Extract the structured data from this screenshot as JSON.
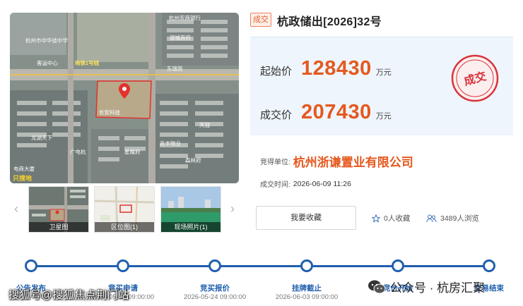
{
  "gallery": {
    "map_labels": [
      "杭州市中华技中学",
      "客运中心",
      "地铁1号线",
      "杭州农商银行",
      "银城首府",
      "东瑞苑",
      "长安科技",
      "天冠",
      "兆丰物业",
      "森林府",
      "龙湖天下",
      "星耀府",
      "广电杭",
      "电商大厦"
    ],
    "watermark_text": "只搜地",
    "thumbnails": [
      {
        "caption": "卫星图"
      },
      {
        "caption": "区位图(1)"
      },
      {
        "caption": "现场照片(1)"
      }
    ],
    "prev_arrow": "‹",
    "next_arrow": "›"
  },
  "lot": {
    "status_tag": "成交",
    "title": "杭政储出[2026]32号",
    "start_price_label": "起始价",
    "start_price": "128430",
    "start_price_unit": "万元",
    "deal_price_label": "成交价",
    "deal_price": "207430",
    "deal_price_unit": "万元",
    "stamp_text": "成交",
    "winner_label": "竞得单位:",
    "winner": "杭州浙谦置业有限公司",
    "deal_time_label": "成交时间:",
    "deal_time": "2026-06-09 11:26"
  },
  "actions": {
    "collect_button": "我要收藏",
    "favorites_text": "0人收藏",
    "views_text": "3489人浏览"
  },
  "timeline": {
    "steps": [
      {
        "label": "公告发布",
        "date": "2026-05-04"
      },
      {
        "label": "竞买申请",
        "date": "2026-05-24 09:00:00"
      },
      {
        "label": "竞买报价",
        "date": "2026-05-24 09:00:00"
      },
      {
        "label": "挂牌截止",
        "date": "2026-06-03 09:00:00"
      },
      {
        "label": "竞价开始",
        "date": ""
      },
      {
        "label": "交易结束",
        "date": ""
      }
    ]
  },
  "overlays": {
    "left_watermark": "搜狐号@搜狐焦点荆门站",
    "right_watermark": "公众号 · 杭房汇聚"
  },
  "colors": {
    "accent_orange": "#e5581f",
    "timeline_blue": "#1f5fae",
    "stamp_red": "#d8343a",
    "price_bg": "#eef5fc"
  }
}
